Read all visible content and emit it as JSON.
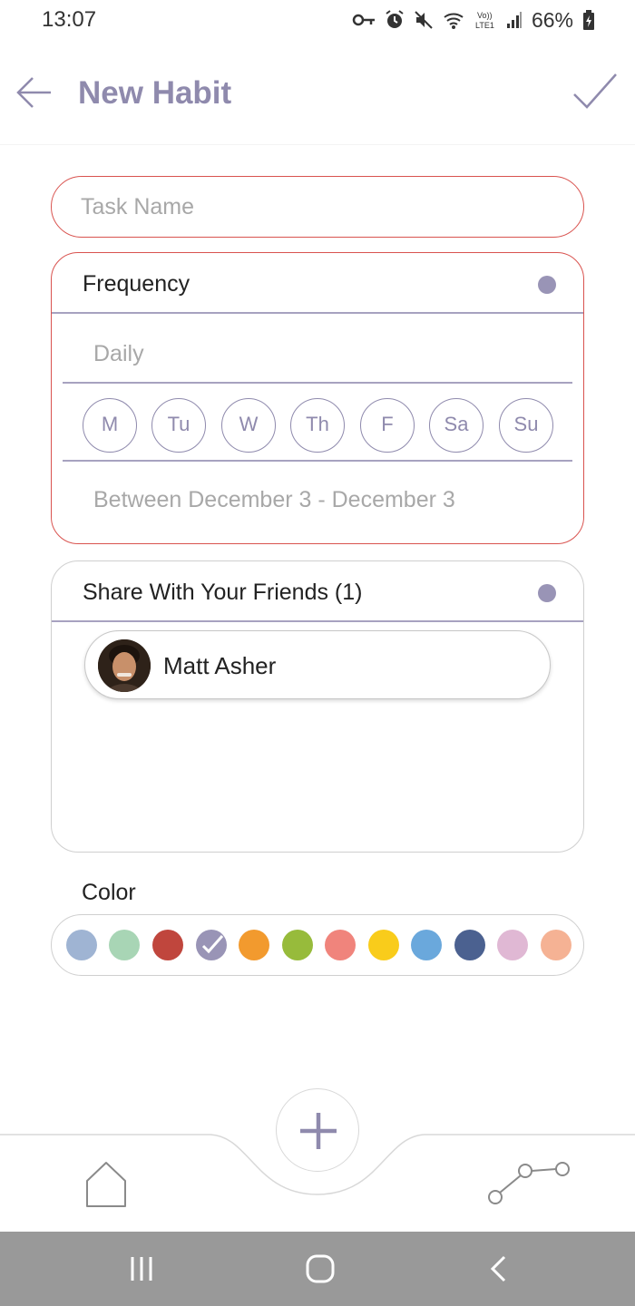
{
  "status_bar": {
    "time": "13:07",
    "battery": "66%",
    "icons": [
      "vpn-key-icon",
      "alarm-icon",
      "mute-icon",
      "wifi-icon",
      "volte-icon",
      "signal-icon",
      "battery-icon"
    ]
  },
  "app_bar": {
    "title": "New Habit",
    "back_icon": "arrow-left-icon",
    "confirm_icon": "checkmark-icon"
  },
  "task": {
    "placeholder": "Task Name",
    "value": ""
  },
  "frequency": {
    "label": "Frequency",
    "type": "Daily",
    "days": [
      "M",
      "Tu",
      "W",
      "Th",
      "F",
      "Sa",
      "Su"
    ],
    "date_range": "Between December 3 - December 3"
  },
  "share": {
    "label": "Share With Your Friends (1)",
    "friends": [
      {
        "name": "Matt Asher"
      }
    ]
  },
  "color": {
    "label": "Color",
    "selected": "#9994b6",
    "swatches": [
      "#9fb4d3",
      "#a8d5b5",
      "#c0463d",
      "#9994b6",
      "#f29a2e",
      "#97bb3b",
      "#f0847c",
      "#f9cc1b",
      "#6aa8dc",
      "#4b6190",
      "#e0b8d4",
      "#f5b294"
    ]
  },
  "theme": {
    "accent": "#8f8aad",
    "error_border": "#d9534f"
  },
  "bottom_nav": {
    "home_icon": "home-icon",
    "add_icon": "plus-icon",
    "stats_icon": "stats-icon"
  },
  "system_nav": {
    "icons": [
      "recents-icon",
      "home-circle-icon",
      "back-chevron-icon"
    ]
  }
}
